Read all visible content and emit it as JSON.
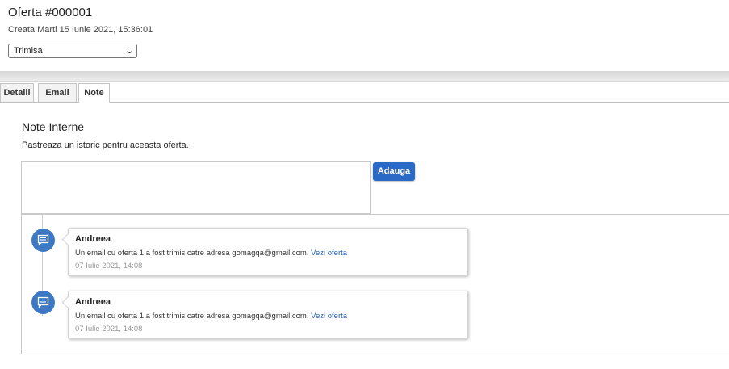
{
  "header": {
    "title": "Oferta #000001",
    "subtitle": "Creata Marti 15 Iunie 2021, 15:36:01",
    "status_value": "Trimisa"
  },
  "tabs": [
    {
      "label": "Detalii",
      "active": false
    },
    {
      "label": "Email",
      "active": false
    },
    {
      "label": "Note",
      "active": true
    }
  ],
  "notes_section": {
    "title": "Note Interne",
    "description": "Pastreaza un istoric pentru aceasta oferta.",
    "input_value": "",
    "add_label": "Adauga"
  },
  "timeline": [
    {
      "author": "Andreea",
      "message": "Un email cu oferta 1 a fost trimis catre adresa gomagqa@gmail.com.",
      "link_label": "Vezi oferta",
      "time": "07 Iulie 2021, 14:08",
      "icon": "comment-icon"
    },
    {
      "author": "Andreea",
      "message": "Un email cu oferta 1 a fost trimis catre adresa gomagqa@gmail.com.",
      "link_label": "Vezi oferta",
      "time": "07 Iulie 2021, 14:08",
      "icon": "comment-icon"
    }
  ],
  "colors": {
    "accent": "#2a6ac6",
    "timeline_icon": "#3c78c3",
    "link": "#2a62b0"
  }
}
